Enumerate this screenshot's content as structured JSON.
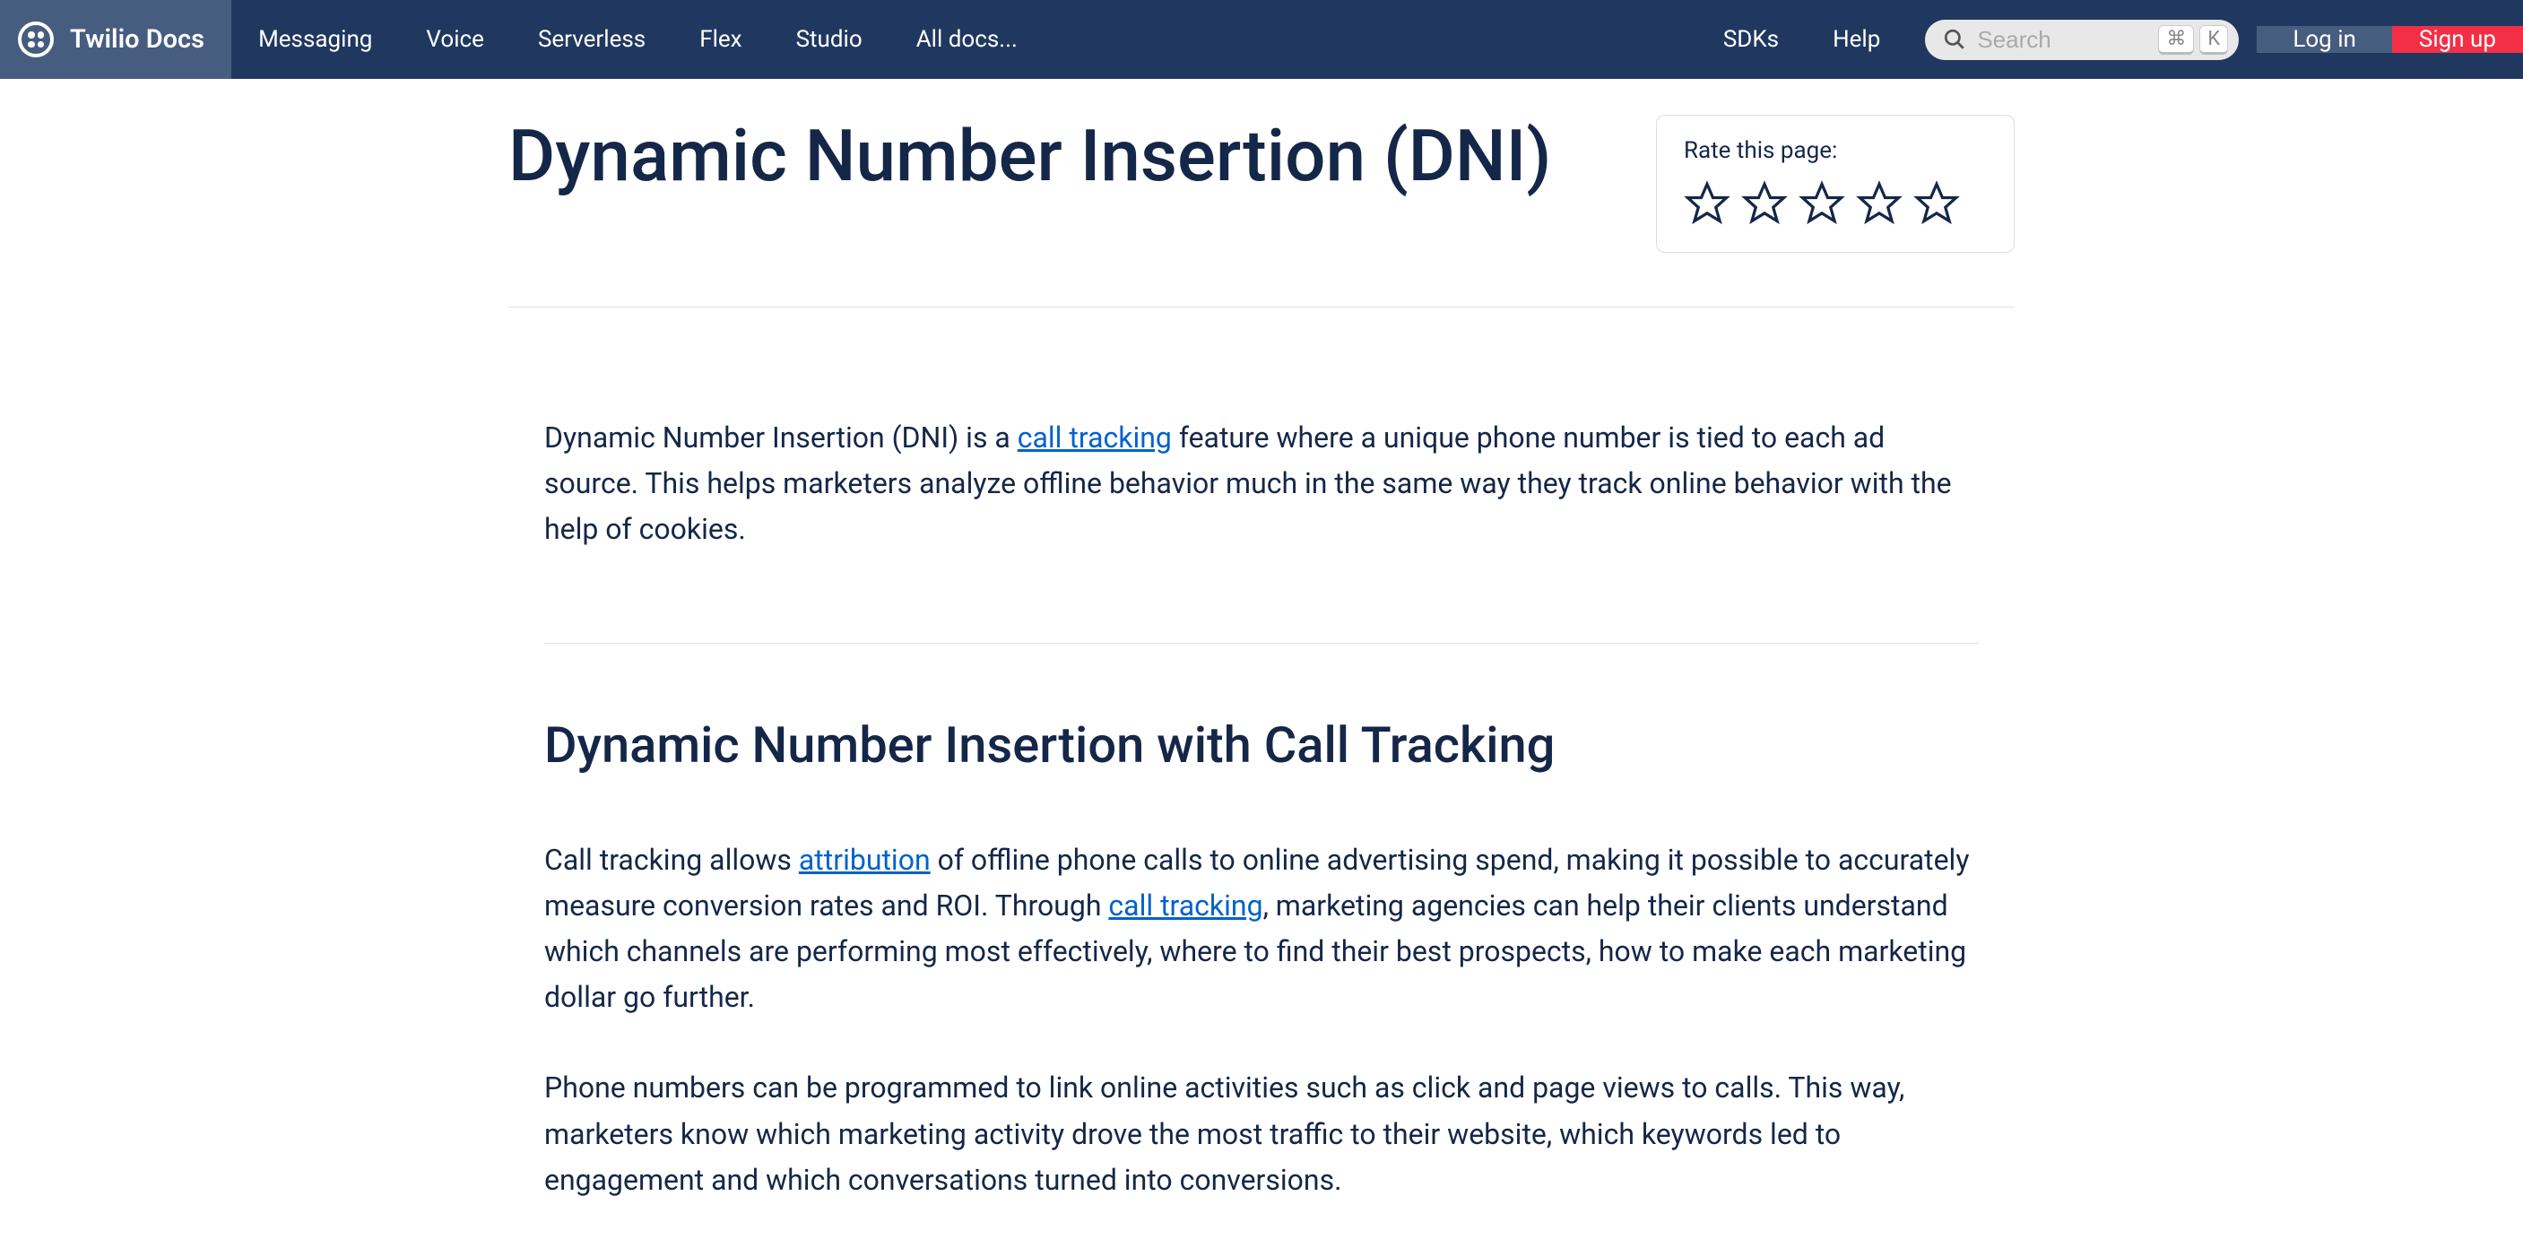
{
  "brand": "Twilio Docs",
  "nav": {
    "items": [
      "Messaging",
      "Voice",
      "Serverless",
      "Flex",
      "Studio",
      "All docs..."
    ],
    "right": [
      "SDKs",
      "Help"
    ]
  },
  "search": {
    "placeholder": "Search",
    "key1": "⌘",
    "key2": "K"
  },
  "auth": {
    "login": "Log in",
    "signup": "Sign up"
  },
  "page": {
    "title": "Dynamic Number Insertion (DNI)",
    "rating_label": "Rate this page:"
  },
  "content": {
    "p1_a": "Dynamic Number Insertion (DNI) is a ",
    "p1_link1": "call tracking",
    "p1_b": " feature where a unique phone number is tied to each ad source. This helps marketers analyze offline behavior much in the same way they track online behavior with the help of cookies.",
    "h2": "Dynamic Number Insertion with Call Tracking",
    "p2_a": "Call tracking allows ",
    "p2_link1": "attribution",
    "p2_b": " of offline phone calls to online advertising spend, making it possible to accurately measure conversion rates and ROI. Through ",
    "p2_link2": "call tracking",
    "p2_c": ", marketing agencies can help their clients understand which channels are performing most effectively, where to find their best prospects, how to make each marketing dollar go further.",
    "p3": "Phone numbers can be programmed to link online activities such as click and page views to calls. This way, marketers know which marketing activity drove the most traffic to their website, which keywords led to engagement and which conversations turned into conversions."
  }
}
